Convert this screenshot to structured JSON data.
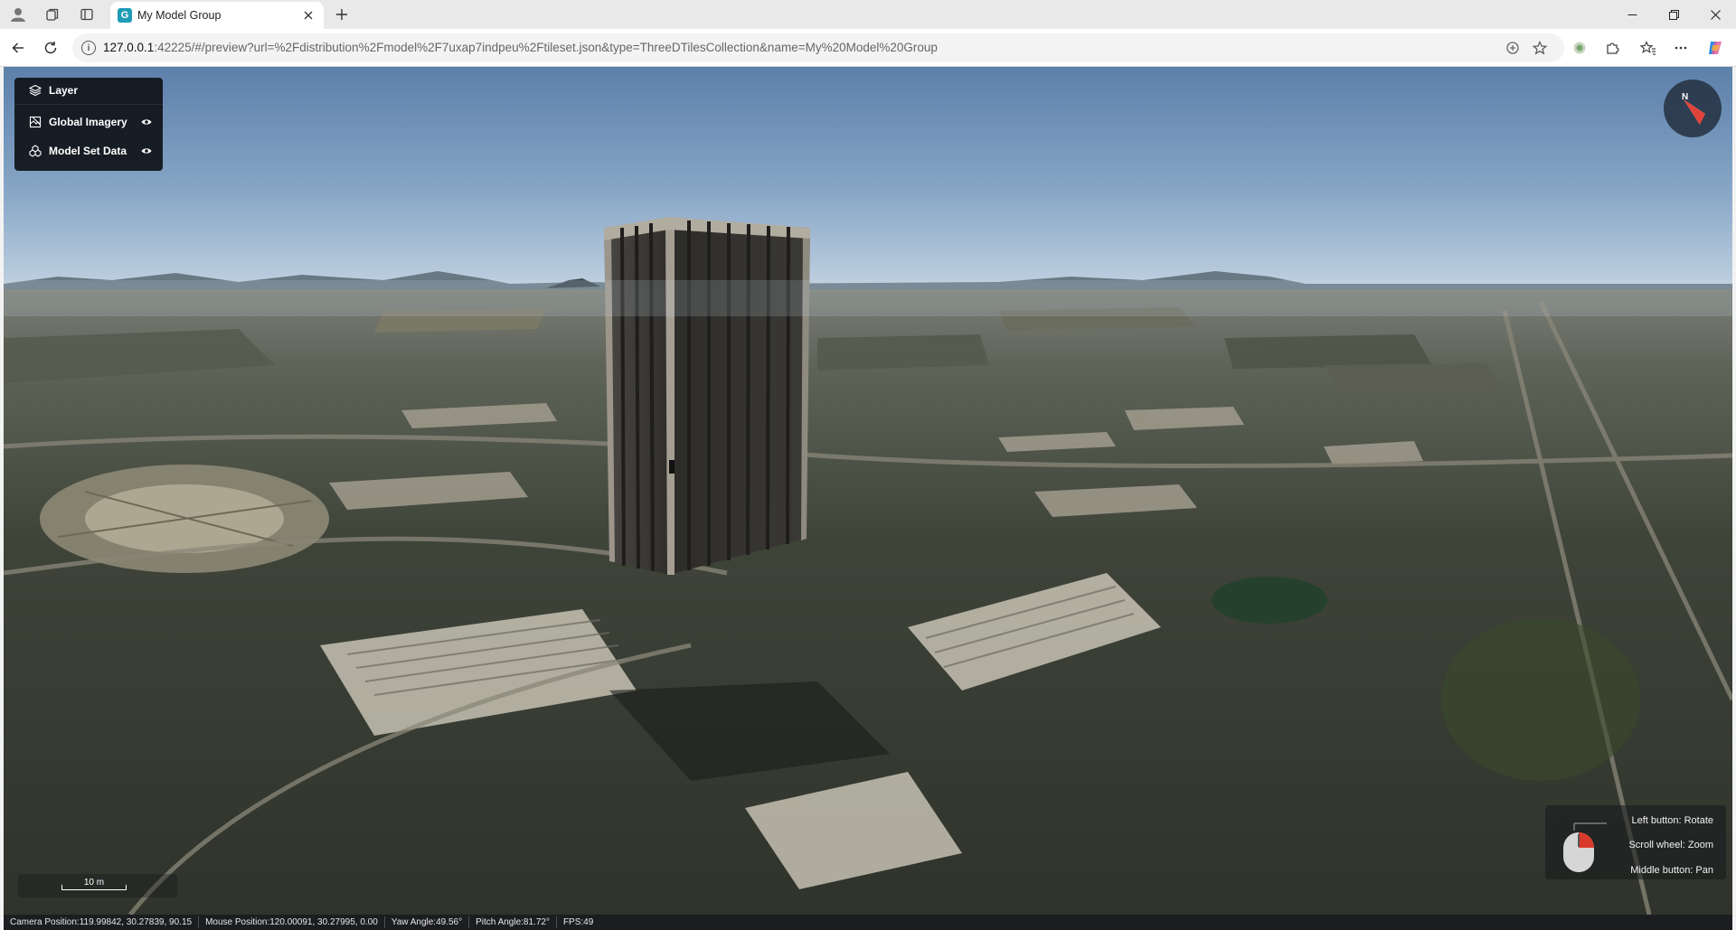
{
  "browser": {
    "tab_title": "My Model Group",
    "tab_favicon_letter": "G",
    "url_host": "127.0.0.1",
    "url_rest": ":42225/#/preview?url=%2Fdistribution%2Fmodel%2F7uxap7indpeu%2Ftileset.json&type=ThreeDTilesCollection&name=My%20Model%20Group",
    "icons": [
      "profile-icon",
      "collections-icon",
      "tab-actions-icon",
      "close-icon",
      "new-tab-icon",
      "back-icon",
      "refresh-icon",
      "site-info-icon",
      "translate-icon",
      "favorite-star-icon",
      "extension-icon",
      "puzzle-icon",
      "favorites-icon",
      "more-icon",
      "copilot-icon",
      "minimize-icon",
      "restore-icon",
      "window-close-icon"
    ]
  },
  "layers": {
    "title": "Layer",
    "items": [
      {
        "label": "Global Imagery",
        "visible": true
      },
      {
        "label": "Model Set Data",
        "visible": true
      }
    ]
  },
  "compass": {
    "north_label": "N"
  },
  "mouse_help": {
    "left": "Left button: Rotate",
    "scroll": "Scroll wheel: Zoom",
    "middle": "Middle button: Pan"
  },
  "scale": {
    "label": "10 m"
  },
  "status": {
    "camera": "Camera Position:119.99842, 30.27839, 90.15",
    "mouse": "Mouse Position:120.00091, 30.27995, 0.00",
    "yaw": "Yaw Angle:49.56°",
    "pitch": "Pitch Angle:81.72°",
    "fps": "FPS:49"
  },
  "colors": {
    "accent_red": "#d93a2b",
    "panel_bg": "#0f1218",
    "sky_top": "#5f82ad",
    "sky_horizon": "#b9cde0"
  }
}
